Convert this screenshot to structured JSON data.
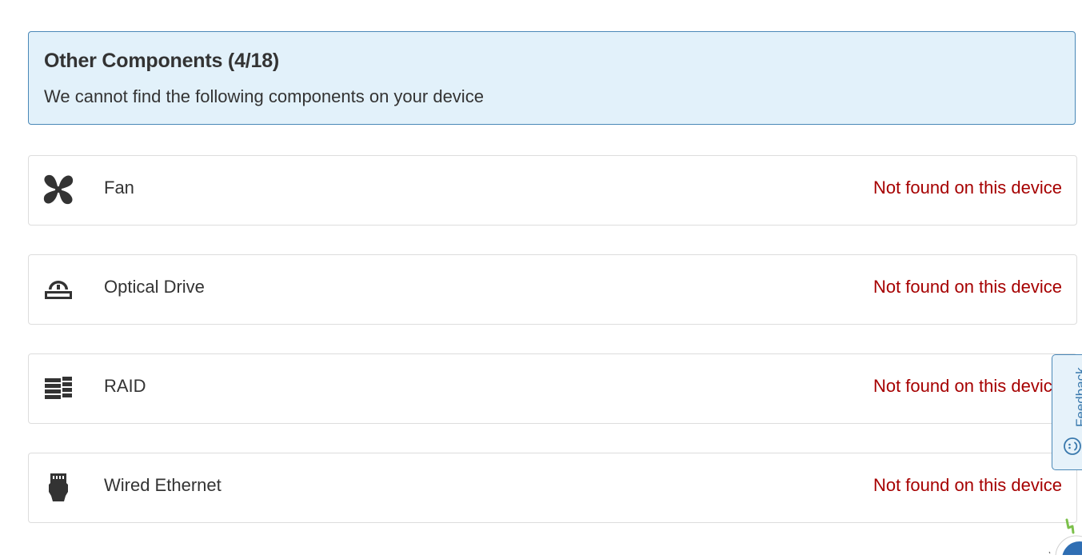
{
  "header": {
    "title": "Other Components (4/18)",
    "subtitle": "We cannot find the following components on your device"
  },
  "components": [
    {
      "name": "Fan",
      "status": "Not found on this device",
      "icon": "fan-icon"
    },
    {
      "name": "Optical Drive",
      "status": "Not found on this device",
      "icon": "optical-drive-icon"
    },
    {
      "name": "RAID",
      "status": "Not found on this device",
      "icon": "raid-icon"
    },
    {
      "name": "Wired Ethernet",
      "status": "Not found on this device",
      "icon": "ethernet-icon"
    }
  ],
  "feedback": {
    "label": "Feedback",
    "icon": "smiley-icon"
  },
  "colors": {
    "banner_background": "#e2f1fa",
    "banner_border": "#4a88b7",
    "status_text": "#a60000",
    "icon": "#333333",
    "feedback_text": "#3a79ad"
  }
}
